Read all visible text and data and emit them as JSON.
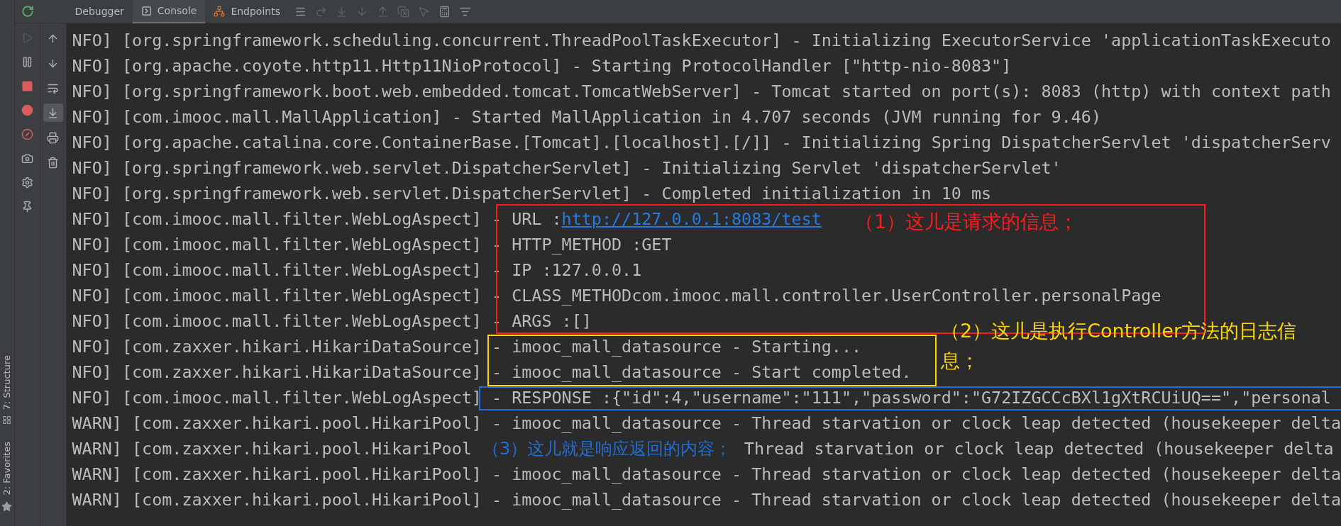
{
  "tabs": [
    {
      "label": "Debugger",
      "selected": false,
      "kind": "plain"
    },
    {
      "label": "Console",
      "selected": true,
      "kind": "console"
    },
    {
      "label": "Endpoints",
      "selected": false,
      "kind": "endpoints"
    }
  ],
  "step_tools": [
    {
      "kind": "menu",
      "disabled": false
    },
    {
      "kind": "step-over",
      "disabled": true
    },
    {
      "kind": "step-into",
      "disabled": true
    },
    {
      "kind": "force-step",
      "disabled": true
    },
    {
      "kind": "step-out",
      "disabled": true
    },
    {
      "kind": "drop-frame",
      "disabled": true
    },
    {
      "kind": "run-cursor",
      "disabled": true
    },
    {
      "kind": "evaluate",
      "disabled": false
    },
    {
      "kind": "trace",
      "disabled": false
    }
  ],
  "debug_tools": [
    {
      "kind": "resume",
      "disabled": true
    },
    {
      "kind": "pause",
      "disabled": false
    },
    {
      "kind": "stop",
      "disabled": false
    },
    {
      "kind": "breakpoints",
      "disabled": false
    },
    {
      "kind": "mute",
      "disabled": false
    },
    {
      "kind": "camera",
      "disabled": false
    },
    {
      "kind": "settings",
      "disabled": false
    },
    {
      "kind": "pin",
      "disabled": false
    }
  ],
  "console_tools": [
    {
      "kind": "up",
      "selected": false
    },
    {
      "kind": "down",
      "selected": false
    },
    {
      "kind": "wrap",
      "selected": false
    },
    {
      "kind": "scroll-end",
      "selected": true
    },
    {
      "kind": "print",
      "selected": false
    },
    {
      "kind": "clear",
      "selected": false
    }
  ],
  "side_tabs": [
    {
      "label": "7: Structure",
      "kind": "structure"
    },
    {
      "label": "2: Favorites",
      "kind": "favorites"
    }
  ],
  "log_lines": [
    {
      "level": "NFO]",
      "logger": "[org.springframework.scheduling.concurrent.ThreadPoolTaskExecutor]",
      "message": "- Initializing ExecutorService 'applicationTaskExecuto"
    },
    {
      "level": "NFO]",
      "logger": "[org.apache.coyote.http11.Http11NioProtocol]",
      "message": "- Starting ProtocolHandler [\"http-nio-8083\"]"
    },
    {
      "level": "NFO]",
      "logger": "[org.springframework.boot.web.embedded.tomcat.TomcatWebServer]",
      "message": "- Tomcat started on port(s): 8083 (http) with context path"
    },
    {
      "level": "NFO]",
      "logger": "[com.imooc.mall.MallApplication]",
      "message": "- Started MallApplication in 4.707 seconds (JVM running for 9.46)"
    },
    {
      "level": "NFO]",
      "logger": "[org.apache.catalina.core.ContainerBase.[Tomcat].[localhost].[/]]",
      "message": "- Initializing Spring DispatcherServlet 'dispatcherServ"
    },
    {
      "level": "NFO]",
      "logger": "[org.springframework.web.servlet.DispatcherServlet]",
      "message": "- Initializing Servlet 'dispatcherServlet'"
    },
    {
      "level": "NFO]",
      "logger": "[org.springframework.web.servlet.DispatcherServlet]",
      "message": "- Completed initialization in 10 ms"
    },
    {
      "level": "NFO]",
      "logger": "[com.imooc.mall.filter.WebLogAspect]",
      "message": "- URL :",
      "link": "http://127.0.0.1:8083/test"
    },
    {
      "level": "NFO]",
      "logger": "[com.imooc.mall.filter.WebLogAspect]",
      "message": "- HTTP_METHOD :GET"
    },
    {
      "level": "NFO]",
      "logger": "[com.imooc.mall.filter.WebLogAspect]",
      "message": "- IP :127.0.0.1"
    },
    {
      "level": "NFO]",
      "logger": "[com.imooc.mall.filter.WebLogAspect]",
      "message": "- CLASS_METHODcom.imooc.mall.controller.UserController.personalPage"
    },
    {
      "level": "NFO]",
      "logger": "[com.imooc.mall.filter.WebLogAspect]",
      "message": "- ARGS :[]"
    },
    {
      "level": "NFO]",
      "logger": "[com.zaxxer.hikari.HikariDataSource]",
      "message": "- imooc_mall_datasource - Starting..."
    },
    {
      "level": "NFO]",
      "logger": "[com.zaxxer.hikari.HikariDataSource]",
      "message": "- imooc_mall_datasource - Start completed."
    },
    {
      "level": "NFO]",
      "logger": "[com.imooc.mall.filter.WebLogAspect]",
      "message": "- RESPONSE :{\"id\":4,\"username\":\"111\",\"password\":\"G72IZGCCcBXl1gXtRCUiUQ==\",\"personal"
    },
    {
      "level": "WARN]",
      "logger": "[com.zaxxer.hikari.pool.HikariPool]",
      "message": "- imooc_mall_datasource - Thread starvation or clock leap detected (housekeeper delta"
    },
    {
      "level": "WARN]",
      "logger": "[com.zaxxer.hikari.pool.HikariPool",
      "message": "Thread starvation or clock leap detected (housekeeper delta",
      "kind": "covered"
    },
    {
      "level": "WARN]",
      "logger": "[com.zaxxer.hikari.pool.HikariPool]",
      "message": "- imooc_mall_datasource - Thread starvation or clock leap detected (housekeeper delta"
    },
    {
      "level": "WARN]",
      "logger": "[com.zaxxer.hikari.pool.HikariPool]",
      "message": "- imooc_mall_datasource - Thread starvation or clock leap detected (housekeeper delta"
    }
  ],
  "annotations": [
    {
      "text": "（1）这儿是请求的信息；",
      "color": "#ff1a1a"
    },
    {
      "text": "（2）这儿是执行Controller方法的日志信息；",
      "color": "#ffd700"
    },
    {
      "text": "（3）这儿就是响应返回的内容；",
      "color": "#1f6fd6"
    }
  ]
}
